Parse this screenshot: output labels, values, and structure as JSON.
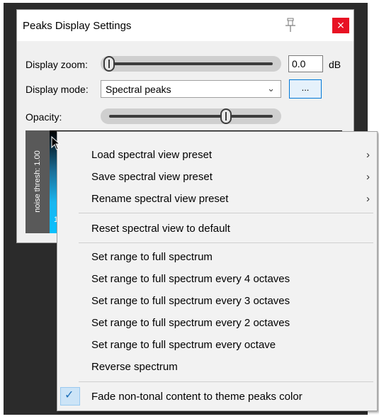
{
  "dialog": {
    "title": "Peaks Display Settings",
    "close_label": "×",
    "zoom_label": "Display zoom:",
    "zoom_value": "0.0",
    "zoom_unit": "dB",
    "mode_label": "Display mode:",
    "mode_value": "Spectral peaks",
    "mode_button_label": "...",
    "opacity_label": "Opacity:",
    "noise_thresh_label": "noise thresh: 1.00",
    "freq_label_partial": "14",
    "icons": {
      "pin": "pin-icon",
      "close": "close-icon",
      "dropdown": "chevron-down-icon"
    },
    "colors": {
      "close": "#e81123",
      "accent": "#0078d7"
    }
  },
  "menu": {
    "items": [
      {
        "label": "Load spectral view preset",
        "submenu": "›"
      },
      {
        "label": "Save spectral view preset",
        "submenu": "›"
      },
      {
        "label": "Rename spectral view preset",
        "submenu": "›"
      },
      {
        "label": "Reset spectral view to default"
      },
      {
        "label": "Set range to full spectrum"
      },
      {
        "label": "Set range to full spectrum every 4 octaves"
      },
      {
        "label": "Set range to full spectrum every 3 octaves"
      },
      {
        "label": "Set range to full spectrum every 2 octaves"
      },
      {
        "label": "Set range to full spectrum every octave"
      },
      {
        "label": "Reverse spectrum"
      },
      {
        "label": "Fade non-tonal content to theme peaks color",
        "checked": true
      }
    ],
    "check_glyph": "✓"
  }
}
